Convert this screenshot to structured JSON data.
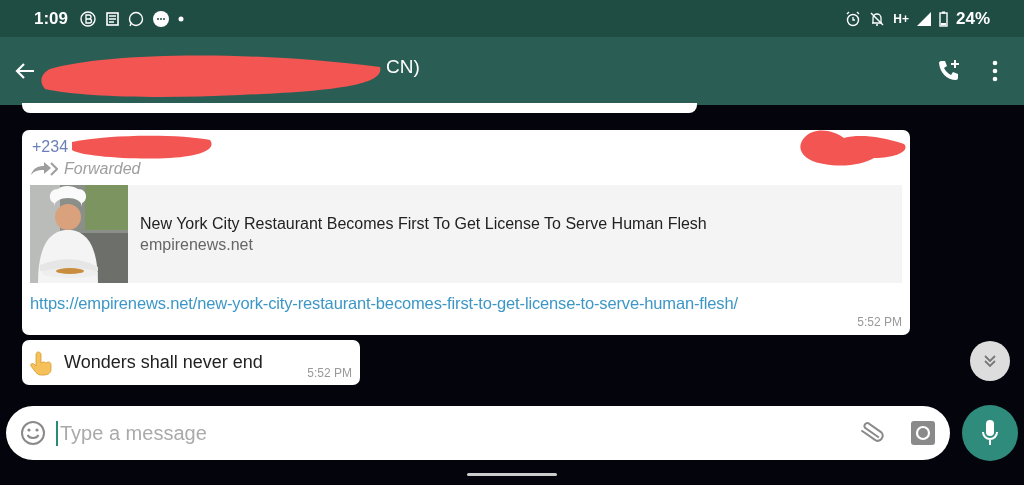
{
  "status_bar": {
    "time": "1:09",
    "battery": "24%",
    "network": "H+"
  },
  "header": {
    "title": "CN)"
  },
  "messages": [
    {
      "kind": "link",
      "sender": "+234",
      "forwarded_label": "Forwarded",
      "preview_title": "New York City Restaurant Becomes First To Get License To Serve Human Flesh",
      "preview_domain": "empirenews.net",
      "url": "https://empirenews.net/new-york-city-restaurant-becomes-first-to-get-license-to-serve-human-flesh/",
      "time": "5:52 PM"
    },
    {
      "kind": "text",
      "text": "Wonders shall never end",
      "time": "5:52 PM"
    }
  ],
  "composer": {
    "placeholder": "Type a message"
  }
}
